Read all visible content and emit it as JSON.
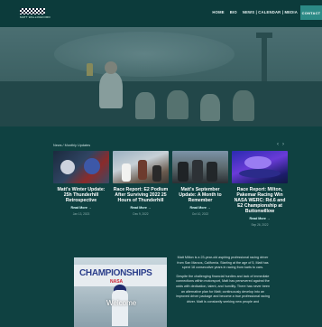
{
  "header": {
    "logo_text": "MATT WALLINGFORD",
    "nav": [
      "HOME",
      "BIO",
      "NEWS | CALENDAR | MEDIA"
    ],
    "contact_label": "CONTACT"
  },
  "news": {
    "section_label": "News / Monthly Updates",
    "prev_arrow": "‹",
    "next_arrow": "›",
    "cards": [
      {
        "title": "Matt's Winter Update: 25h Thunderhill Retrospective",
        "read_more": "Read More →",
        "date": "Jan 13, 2023"
      },
      {
        "title": "Race Report: E2 Podium After Surviving 2022 25 Hours of Thunderhill",
        "read_more": "Read More →",
        "date": "Dec 9, 2022"
      },
      {
        "title": "Matt's September Update: A Month to Remember",
        "read_more": "Read More →",
        "date": "Oct 10, 2022"
      },
      {
        "title": "Race Report: Milton, Pakemar Racing Win NASA WERC: Rd.6 and E2 Championship at Buttonwillow",
        "read_more": "Read More →",
        "date": "Sep 26, 2022"
      }
    ]
  },
  "welcome": {
    "banner_text": "CHAMPIONSHIPS",
    "banner_sub": "NASA",
    "welcome_label": "Welcome",
    "bio_paragraphs": [
      "Matt Milton is a 23-year-old aspiring professional racing driver from San Marcos, California. Starting at the age of 5, Matt has spent 18 consecutive years in racing from karts to cars.",
      "Despite the challenging financial hurdles and lack of immediate connections within motorsport, Matt has persevered against the odds with dedication, talent, and humility. There has never been an alternative plan for Matt; continuously develop into an improved driver package and become a true professional racing driver. Matt is constantly seeking new people and"
    ]
  }
}
